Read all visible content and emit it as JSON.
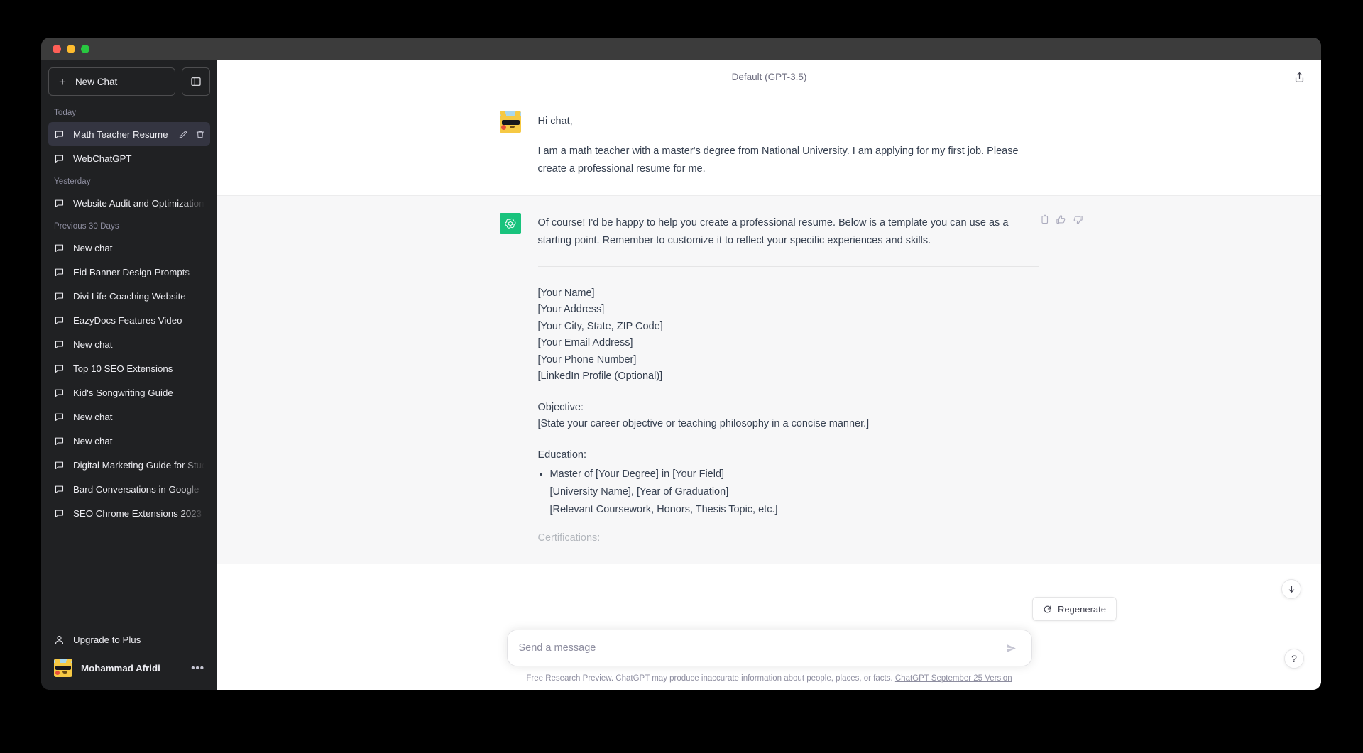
{
  "window": {
    "traffic_lights": [
      "close",
      "minimize",
      "maximize"
    ]
  },
  "sidebar": {
    "new_chat_label": "New Chat",
    "toggle_icon": "sidebar-panel-icon",
    "groups": [
      {
        "label": "Today",
        "items": [
          {
            "title": "Math Teacher Resume",
            "icon": "chat-bubble-icon",
            "active": true
          },
          {
            "title": "WebChatGPT",
            "icon": "chat-bubble-icon",
            "active": false
          }
        ]
      },
      {
        "label": "Yesterday",
        "items": [
          {
            "title": "Website Audit and Optimization",
            "icon": "chat-bubble-icon",
            "active": false
          }
        ]
      },
      {
        "label": "Previous 30 Days",
        "items": [
          {
            "title": "New chat",
            "icon": "chat-bubble-icon",
            "active": false
          },
          {
            "title": "Eid Banner Design Prompts",
            "icon": "chat-bubble-icon",
            "active": false
          },
          {
            "title": "Divi Life Coaching Website",
            "icon": "chat-bubble-icon",
            "active": false
          },
          {
            "title": "EazyDocs Features Video",
            "icon": "chat-bubble-icon",
            "active": false
          },
          {
            "title": "New chat",
            "icon": "chat-bubble-icon",
            "active": false
          },
          {
            "title": "Top 10 SEO Extensions",
            "icon": "chat-bubble-icon",
            "active": false
          },
          {
            "title": "Kid's Songwriting Guide",
            "icon": "chat-bubble-icon",
            "active": false
          },
          {
            "title": "New chat",
            "icon": "chat-bubble-icon",
            "active": false
          },
          {
            "title": "New chat",
            "icon": "chat-bubble-icon",
            "active": false
          },
          {
            "title": "Digital Marketing Guide for Students",
            "icon": "chat-bubble-icon",
            "active": false
          },
          {
            "title": "Bard Conversations in Google",
            "icon": "chat-bubble-icon",
            "active": false
          },
          {
            "title": "SEO Chrome Extensions 2023",
            "icon": "chat-bubble-icon",
            "active": false
          }
        ]
      }
    ],
    "upgrade_label": "Upgrade to Plus",
    "account_name": "Mohammad Afridi",
    "account_menu_glyph": "•••",
    "row_actions": [
      "edit-icon",
      "delete-icon"
    ]
  },
  "header": {
    "model_title": "Default (GPT-3.5)",
    "share_icon": "share-upload-icon"
  },
  "messages": [
    {
      "role": "user",
      "avatar": "pikachu-avatar",
      "paragraphs": [
        "Hi chat,",
        "I am a math teacher with a master's degree from National University. I am applying for my first job. Please create a professional resume for me."
      ]
    },
    {
      "role": "assistant",
      "avatar": "openai-logo-icon",
      "paragraphs": [
        "Of course! I'd be happy to help you create a professional resume. Below is a template you can use as a starting point. Remember to customize it to reflect your specific experiences and skills."
      ],
      "actions": [
        "copy-icon",
        "thumbs-up-icon",
        "thumbs-down-icon"
      ],
      "contact_block": [
        "[Your Name]",
        "[Your Address]",
        "[Your City, State, ZIP Code]",
        "[Your Email Address]",
        "[Your Phone Number]",
        "[LinkedIn Profile (Optional)]"
      ],
      "objective_heading": "Objective:",
      "objective_text": "[State your career objective or teaching philosophy in a concise manner.]",
      "education_heading": "Education:",
      "education_bullet": [
        "Master of [Your Degree] in [Your Field]",
        "[University Name], [Year of Graduation]",
        "[Relevant Coursework, Honors, Thesis Topic, etc.]"
      ],
      "cut_off_heading": "Certifications:"
    }
  ],
  "composer": {
    "regenerate_label": "Regenerate",
    "regenerate_icon": "refresh-icon",
    "placeholder": "Send a message",
    "value": "",
    "send_icon": "send-paper-plane-icon",
    "footer_text": "Free Research Preview. ChatGPT may produce inaccurate information about people, places, or facts.",
    "footer_link": "ChatGPT September 25 Version"
  },
  "floating": {
    "scroll_down_icon": "arrow-down-icon",
    "help_label": "?"
  },
  "colors": {
    "sidebar_bg": "#202123",
    "active_item_bg": "#343541",
    "assistant_row_bg": "#f7f7f8",
    "user_row_bg": "#ffffff",
    "brand_green": "#19c37d",
    "text_primary": "#374151",
    "muted": "#8e8ea0"
  }
}
